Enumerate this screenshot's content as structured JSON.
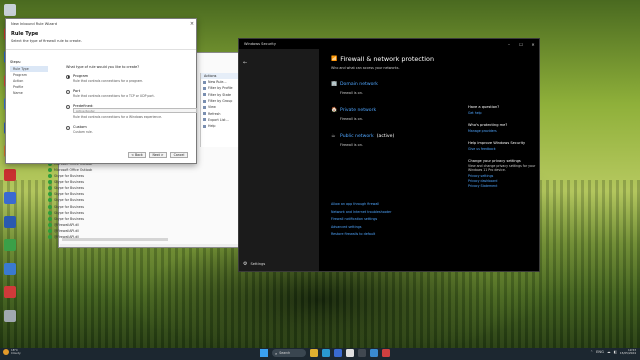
{
  "colors": {
    "security_bg": "#000000",
    "security_nav_bg": "#1b1b1b",
    "link_blue": "#4fa6ff",
    "taskbar_bg": "#1c2730",
    "rule_enabled_green": "#2e9e3a"
  },
  "desktop": {
    "icons": [
      {
        "name": "recycle-bin-icon",
        "color": "#c8d0d8"
      },
      {
        "name": "app-icon-red",
        "color": "#d33a2a"
      },
      {
        "name": "app-icon-blue",
        "color": "#2a6ad3"
      },
      {
        "name": "app-icon-red-2",
        "color": "#e04a3a"
      },
      {
        "name": "app-icon-blue-2",
        "color": "#3a7ae0"
      },
      {
        "name": "app-icon-blue-3",
        "color": "#2f5fc0"
      },
      {
        "name": "app-icon-orange",
        "color": "#e07a2a"
      },
      {
        "name": "app-icon-red-3",
        "color": "#c83030"
      },
      {
        "name": "app-icon-blue-4",
        "color": "#3a6ad0"
      },
      {
        "name": "app-icon-blue-5",
        "color": "#2a5ab0"
      },
      {
        "name": "app-icon-green",
        "color": "#3aa048"
      },
      {
        "name": "app-icon-blue-6",
        "color": "#3a7ad0"
      },
      {
        "name": "app-icon-red-4",
        "color": "#d03a3a"
      },
      {
        "name": "app-icon-gray",
        "color": "#a0a8b0"
      }
    ]
  },
  "wizard": {
    "title": "New Inbound Rule Wizard",
    "close_glyph": "×",
    "heading": "Rule Type",
    "subheading": "Select the type of firewall rule to create.",
    "steps_title": "Steps:",
    "steps": [
      "Rule Type",
      "Program",
      "Action",
      "Profile",
      "Name"
    ],
    "question": "What type of rule would you like to create?",
    "options": [
      {
        "label": "Program",
        "desc": "Rule that controls connections for a program.",
        "selected": true
      },
      {
        "label": "Port",
        "desc": "Rule that controls connections for a TCP or UDP port.",
        "selected": false
      },
      {
        "label": "Predefined:",
        "desc": "Rule that controls connections for a Windows experience.",
        "selected": false,
        "select_value": "Active Router"
      },
      {
        "label": "Custom",
        "desc": "Custom rule.",
        "selected": false
      }
    ],
    "buttons": {
      "back": "< Back",
      "next": "Next >",
      "cancel": "Cancel"
    }
  },
  "legacy": {
    "actions_header": "Actions",
    "actions": [
      {
        "label": "New Rule...",
        "arrow": false
      },
      {
        "label": "Filter by Profile",
        "arrow": true
      },
      {
        "label": "Filter by State",
        "arrow": true
      },
      {
        "label": "Filter by Group",
        "arrow": true
      },
      {
        "label": "View",
        "arrow": true
      },
      {
        "label": "Refresh",
        "arrow": false
      },
      {
        "label": "Export List...",
        "arrow": false
      },
      {
        "label": "Help",
        "arrow": false
      }
    ],
    "rules": [
      "BITS-PeerCaching",
      "BITS-PeerCaching",
      "BITS-PeerCaching",
      "BITS-PeerCaching",
      "Microsoft Lync",
      "Microsoft Lync",
      "Microsoft Lync",
      "Microsoft Lync UcMapi",
      "Microsoft Lync UcMapi",
      "Microsoft Office Outlook",
      "Microsoft Office Outlook",
      "Skype for Business",
      "Skype for Business",
      "Skype for Business",
      "Skype for Business",
      "Skype for Business",
      "Skype for Business",
      "Skype for Business",
      "Skype for Business",
      "@FirewallAPI.dll",
      "@FirewallAPI.dll",
      "@FirewallAPI.dll"
    ]
  },
  "security": {
    "title": "Windows Security",
    "controls": [
      "–",
      "☐",
      "✕"
    ],
    "back_glyph": "←",
    "settings_label": "Settings",
    "heading": "Firewall & network protection",
    "subtext": "Who and what can access your networks.",
    "networks": [
      {
        "title": "Domain network",
        "active": "",
        "status": "Firewall is on."
      },
      {
        "title": "Private network",
        "active": "",
        "status": "Firewall is on."
      },
      {
        "title": "Public network",
        "active": "(active)",
        "status": "Firewall is on."
      }
    ],
    "links": [
      "Allow an app through firewall",
      "Network and Internet troubleshooter",
      "Firewall notification settings",
      "Advanced settings",
      "Restore firewalls to default"
    ],
    "right": {
      "question": {
        "title": "Have a question?",
        "link": "Get help"
      },
      "protect": {
        "title": "Who's protecting me?",
        "link": "Manage providers"
      },
      "improve": {
        "title": "Help improve Windows Security",
        "link": "Give us feedback"
      },
      "privacy": {
        "title": "Change your privacy settings",
        "text": "View and change privacy settings for your Windows 11 Pro device.",
        "links": [
          "Privacy settings",
          "Privacy dashboard",
          "Privacy Statement"
        ]
      }
    }
  },
  "taskbar": {
    "weather_temp": "18°C",
    "weather_desc": "Cloudy",
    "search_label": "Search",
    "search_glyph": "⌕",
    "apps": [
      {
        "name": "taskbar-app-files",
        "color": "#e0b030"
      },
      {
        "name": "taskbar-app-edge",
        "color": "#2a9ad0"
      },
      {
        "name": "taskbar-app-store",
        "color": "#3a6ad0"
      },
      {
        "name": "taskbar-app-chrome",
        "color": "#e0e0e0"
      },
      {
        "name": "taskbar-app-terminal",
        "color": "#404850"
      },
      {
        "name": "taskbar-app-security",
        "color": "#3a8ad0"
      },
      {
        "name": "taskbar-app-firewall",
        "color": "#d04040"
      }
    ],
    "tray": [
      "⌃",
      "ENG",
      "☁",
      "◧"
    ],
    "time": "19:53",
    "date": "15/05/2024"
  }
}
